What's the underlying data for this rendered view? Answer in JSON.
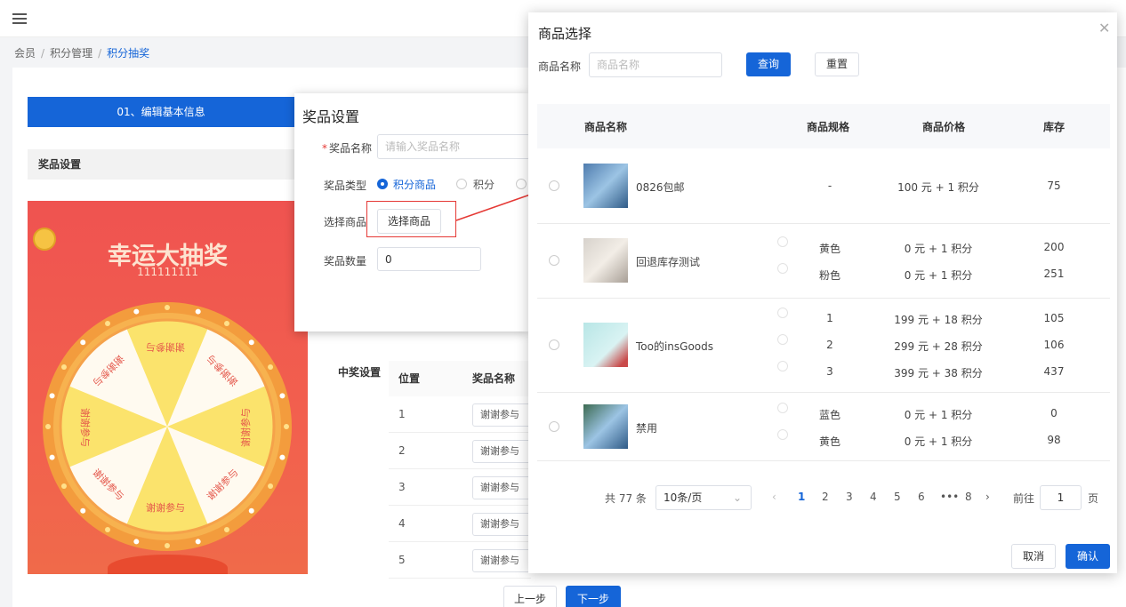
{
  "breadcrumb": {
    "items": [
      "会员",
      "积分管理"
    ],
    "current": "积分抽奖"
  },
  "steps": {
    "step1": "01、编辑基本信息"
  },
  "section": {
    "prize_setting": "奖品设置",
    "win_setting": "中奖设置"
  },
  "wheel": {
    "title": "幸运大抽奖",
    "subtitle": "111111111",
    "prize": "谢谢参与"
  },
  "prize_dialog": {
    "title": "奖品设置",
    "name_label": "奖品名称",
    "name_placeholder": "请输入奖品名称",
    "type_label": "奖品类型",
    "type_options": [
      "积分商品",
      "积分"
    ],
    "select_label": "选择商品",
    "select_button": "选择商品",
    "qty_label": "奖品数量",
    "qty_value": "0"
  },
  "lower_table": {
    "headers": [
      "位置",
      "奖品名称"
    ],
    "rows": [
      {
        "pos": "1",
        "name": "谢谢参与"
      },
      {
        "pos": "2",
        "name": "谢谢参与"
      },
      {
        "pos": "3",
        "name": "谢谢参与"
      },
      {
        "pos": "4",
        "name": "谢谢参与"
      },
      {
        "pos": "5",
        "name": "谢谢参与"
      }
    ]
  },
  "footer": {
    "prev": "上一步",
    "next": "下一步"
  },
  "modal": {
    "title": "商品选择",
    "search_label": "商品名称",
    "search_placeholder": "商品名称",
    "query": "查询",
    "reset": "重置",
    "headers": {
      "name": "商品名称",
      "spec": "商品规格",
      "price": "商品价格",
      "stock": "库存"
    },
    "products": [
      {
        "name": "0826包邮",
        "specs": [
          {
            "spec": "-",
            "price": "100 元 + 1 积分",
            "stock": "75"
          }
        ]
      },
      {
        "name": "回退库存测试",
        "specs": [
          {
            "spec": "黄色",
            "price": "0 元 + 1 积分",
            "stock": "200"
          },
          {
            "spec": "粉色",
            "price": "0 元 + 1 积分",
            "stock": "251"
          }
        ]
      },
      {
        "name": "Too的insGoods",
        "specs": [
          {
            "spec": "1",
            "price": "199 元 + 18 积分",
            "stock": "105"
          },
          {
            "spec": "2",
            "price": "299 元 + 28 积分",
            "stock": "106"
          },
          {
            "spec": "3",
            "price": "399 元 + 38 积分",
            "stock": "437"
          }
        ]
      },
      {
        "name": "禁用",
        "specs": [
          {
            "spec": "蓝色",
            "price": "0 元 + 1 积分",
            "stock": "0"
          },
          {
            "spec": "黄色",
            "price": "0 元 + 1 积分",
            "stock": "98"
          }
        ]
      }
    ],
    "pagination": {
      "total": "共 77 条",
      "page_size": "10条/页",
      "pages": [
        "1",
        "2",
        "3",
        "4",
        "5",
        "6",
        "•••",
        "8"
      ],
      "goto": "前往",
      "goto_value": "1",
      "page_unit": "页"
    },
    "cancel": "取消",
    "confirm": "确认"
  }
}
